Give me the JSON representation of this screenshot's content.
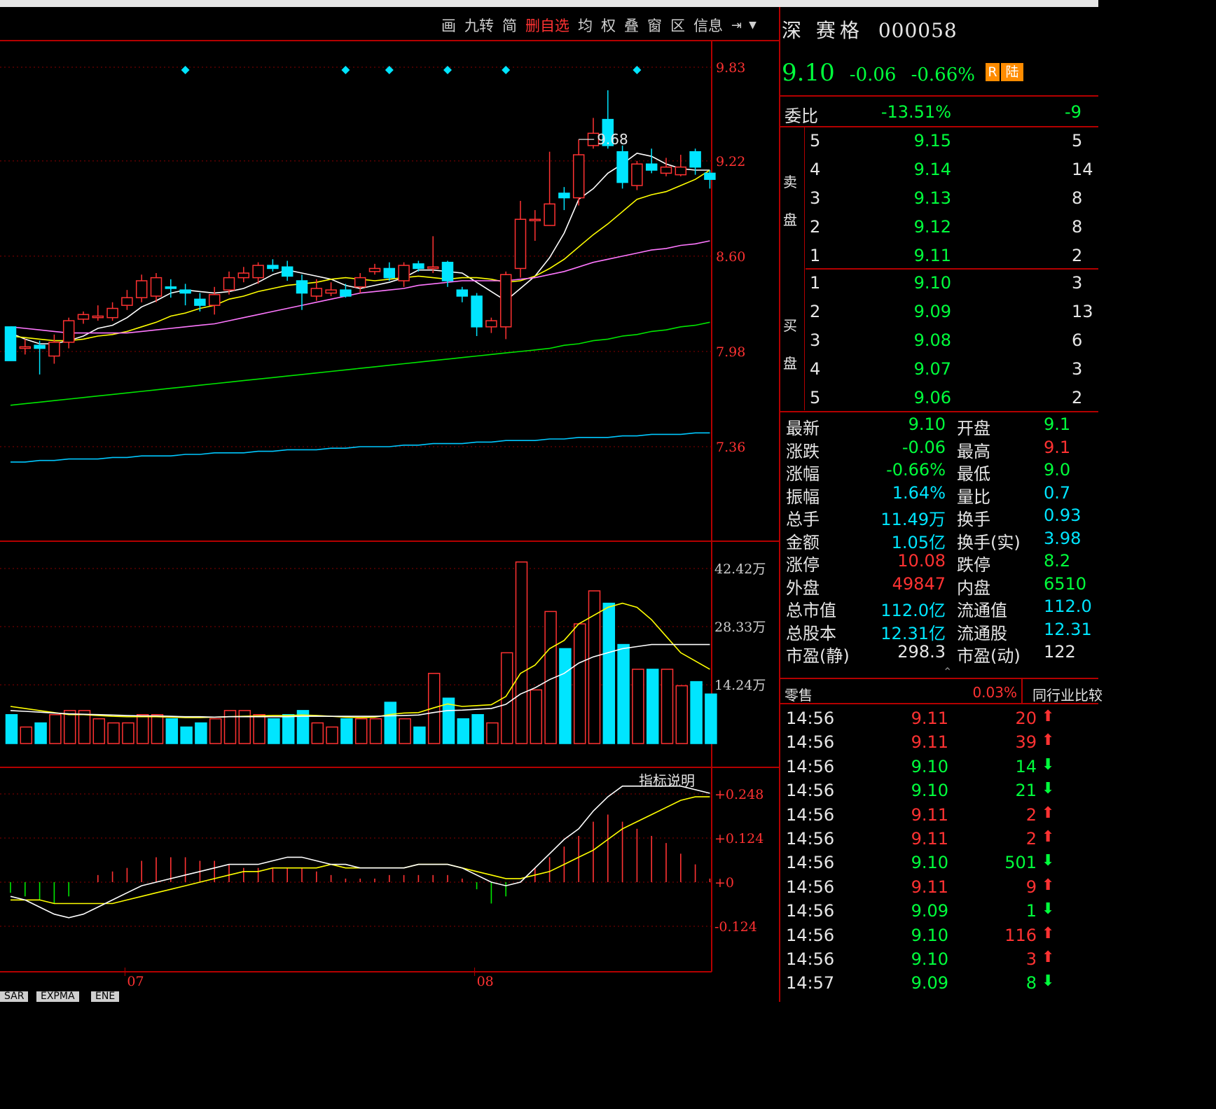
{
  "toolbar": {
    "items": [
      "画",
      "九转",
      "简",
      "删自选",
      "均",
      "权",
      "叠",
      "窗",
      "区",
      "信息"
    ],
    "highlight_index": 3,
    "end_icon": "goto-end-icon",
    "dropdown_icon": "dropdown-icon"
  },
  "stock": {
    "market": "深",
    "name": "赛格",
    "code": "000058",
    "price": "9.10",
    "change": "-0.06",
    "change_pct": "-0.66%",
    "badge_r": "R",
    "badge_lu": "陆"
  },
  "order_book": {
    "weibi_label": "委比",
    "weibi_value": "-13.51%",
    "weicha_partial": "-9",
    "sell_label": [
      "卖",
      "盘"
    ],
    "buy_label": [
      "买",
      "盘"
    ],
    "sell": [
      {
        "level": "5",
        "price": "9.15",
        "vol": "5"
      },
      {
        "level": "4",
        "price": "9.14",
        "vol": "14"
      },
      {
        "level": "3",
        "price": "9.13",
        "vol": "8"
      },
      {
        "level": "2",
        "price": "9.12",
        "vol": "8"
      },
      {
        "level": "1",
        "price": "9.11",
        "vol": "2"
      }
    ],
    "buy": [
      {
        "level": "1",
        "price": "9.10",
        "vol": "3"
      },
      {
        "level": "2",
        "price": "9.09",
        "vol": "13"
      },
      {
        "level": "3",
        "price": "9.08",
        "vol": "6"
      },
      {
        "level": "4",
        "price": "9.07",
        "vol": "3"
      },
      {
        "level": "5",
        "price": "9.06",
        "vol": "2"
      }
    ]
  },
  "stats": [
    {
      "l1": "最新",
      "v1": "9.10",
      "c1": "grn",
      "l2": "开盘",
      "v2": "9.1",
      "c2": "grn"
    },
    {
      "l1": "涨跌",
      "v1": "-0.06",
      "c1": "grn",
      "l2": "最高",
      "v2": "9.1",
      "c2": "red"
    },
    {
      "l1": "涨幅",
      "v1": "-0.66%",
      "c1": "grn",
      "l2": "最低",
      "v2": "9.0",
      "c2": "grn"
    },
    {
      "l1": "振幅",
      "v1": "1.64%",
      "c1": "cyan",
      "l2": "量比",
      "v2": "0.7",
      "c2": "cyan"
    },
    {
      "l1": "总手",
      "v1": "11.49万",
      "c1": "cyan",
      "l2": "换手",
      "v2": "0.93",
      "c2": "cyan"
    },
    {
      "l1": "金额",
      "v1": "1.05亿",
      "c1": "cyan",
      "l2": "换手(实)",
      "v2": "3.98",
      "c2": "cyan"
    },
    {
      "l1": "涨停",
      "v1": "10.08",
      "c1": "red",
      "l2": "跌停",
      "v2": "8.2",
      "c2": "grn"
    },
    {
      "l1": "外盘",
      "v1": "49847",
      "c1": "red",
      "l2": "内盘",
      "v2": "6510",
      "c2": "grn"
    },
    {
      "l1": "总市值",
      "v1": "112.0亿",
      "c1": "cyan",
      "l2": "流通值",
      "v2": "112.0",
      "c2": "cyan"
    },
    {
      "l1": "总股本",
      "v1": "12.31亿",
      "c1": "cyan",
      "l2": "流通股",
      "v2": "12.31",
      "c2": "cyan"
    },
    {
      "l1": "市盈(静)",
      "v1": "298.3",
      "c1": "wht",
      "l2": "市盈(动)",
      "v2": "122",
      "c2": "wht"
    }
  ],
  "sector": {
    "label": "零售",
    "value": "0.03%",
    "compare_label": "同行业比较",
    "collapse_icon": "chevron-up-icon"
  },
  "ticks": [
    {
      "time": "14:56",
      "price": "9.11",
      "vol": "20",
      "dir": "up"
    },
    {
      "time": "14:56",
      "price": "9.11",
      "vol": "39",
      "dir": "up"
    },
    {
      "time": "14:56",
      "price": "9.10",
      "vol": "14",
      "dir": "down"
    },
    {
      "time": "14:56",
      "price": "9.10",
      "vol": "21",
      "dir": "down"
    },
    {
      "time": "14:56",
      "price": "9.11",
      "vol": "2",
      "dir": "up"
    },
    {
      "time": "14:56",
      "price": "9.11",
      "vol": "2",
      "dir": "up"
    },
    {
      "time": "14:56",
      "price": "9.10",
      "vol": "501",
      "dir": "down"
    },
    {
      "time": "14:56",
      "price": "9.11",
      "vol": "9",
      "dir": "up"
    },
    {
      "time": "14:56",
      "price": "9.09",
      "vol": "1",
      "dir": "down"
    },
    {
      "time": "14:56",
      "price": "9.10",
      "vol": "116",
      "dir": "up"
    },
    {
      "time": "14:56",
      "price": "9.10",
      "vol": "3",
      "dir": "up"
    },
    {
      "time": "14:57",
      "price": "9.09",
      "vol": "8",
      "dir": "down"
    }
  ],
  "bottom_tabs": [
    "SAR",
    "EXPMA",
    "ENE"
  ],
  "indicator_help": "指标说明",
  "chart_data": {
    "type": "candlestick",
    "price_axis": {
      "ticks": [
        "9.83",
        "9.22",
        "8.60",
        "7.98",
        "7.36"
      ],
      "range": [
        6.8,
        10.0
      ]
    },
    "volume_axis": {
      "ticks": [
        "42.42万",
        "28.33万",
        "14.24万"
      ],
      "range": [
        0,
        44
      ]
    },
    "macd_axis": {
      "ticks": [
        "+0.248",
        "+0.124",
        "+0",
        "-0.124"
      ],
      "range": [
        -0.22,
        0.32
      ]
    },
    "x_labels": [
      "07",
      "08"
    ],
    "x_label_index": [
      8,
      32
    ],
    "high_annotation": "9.68",
    "high_index": 39,
    "diamond_indices": [
      12,
      23,
      26,
      30,
      34,
      43
    ],
    "candles": [
      [
        8.14,
        7.92,
        8.14,
        7.92
      ],
      [
        8.0,
        8.01,
        8.06,
        7.96
      ],
      [
        8.02,
        8.0,
        8.05,
        7.83
      ],
      [
        7.95,
        8.04,
        8.09,
        7.9
      ],
      [
        8.04,
        8.18,
        8.2,
        8.0
      ],
      [
        8.19,
        8.22,
        8.24,
        8.16
      ],
      [
        8.2,
        8.21,
        8.28,
        8.18
      ],
      [
        8.2,
        8.26,
        8.3,
        8.18
      ],
      [
        8.28,
        8.33,
        8.38,
        8.25
      ],
      [
        8.33,
        8.44,
        8.48,
        8.3
      ],
      [
        8.34,
        8.46,
        8.49,
        8.3
      ],
      [
        8.4,
        8.39,
        8.45,
        8.33
      ],
      [
        8.38,
        8.36,
        8.42,
        8.28
      ],
      [
        8.32,
        8.28,
        8.36,
        8.24
      ],
      [
        8.28,
        8.35,
        8.4,
        8.22
      ],
      [
        8.38,
        8.46,
        8.5,
        8.35
      ],
      [
        8.46,
        8.49,
        8.53,
        8.43
      ],
      [
        8.46,
        8.54,
        8.56,
        8.42
      ],
      [
        8.54,
        8.52,
        8.58,
        8.5
      ],
      [
        8.53,
        8.47,
        8.57,
        8.44
      ],
      [
        8.44,
        8.36,
        8.48,
        8.25
      ],
      [
        8.34,
        8.39,
        8.45,
        8.31
      ],
      [
        8.36,
        8.38,
        8.43,
        8.34
      ],
      [
        8.38,
        8.34,
        8.42,
        8.33
      ],
      [
        8.4,
        8.46,
        8.49,
        8.36
      ],
      [
        8.5,
        8.52,
        8.55,
        8.48
      ],
      [
        8.52,
        8.46,
        8.56,
        8.44
      ],
      [
        8.44,
        8.54,
        8.56,
        8.4
      ],
      [
        8.55,
        8.52,
        8.57,
        8.5
      ],
      [
        8.52,
        8.53,
        8.73,
        8.49
      ],
      [
        8.56,
        8.44,
        8.57,
        8.4
      ],
      [
        8.38,
        8.34,
        8.4,
        8.3
      ],
      [
        8.34,
        8.14,
        8.36,
        8.08
      ],
      [
        8.14,
        8.18,
        8.2,
        8.1
      ],
      [
        8.14,
        8.48,
        8.5,
        8.06
      ],
      [
        8.52,
        8.84,
        8.96,
        8.46
      ],
      [
        8.84,
        8.84,
        8.9,
        8.7
      ],
      [
        8.8,
        8.94,
        9.28,
        8.8
      ],
      [
        9.01,
        8.98,
        9.05,
        8.9
      ],
      [
        8.98,
        9.26,
        9.36,
        8.93
      ],
      [
        9.32,
        9.4,
        9.5,
        9.3
      ],
      [
        9.49,
        9.32,
        9.68,
        9.3
      ],
      [
        9.28,
        9.08,
        9.32,
        9.04
      ],
      [
        9.06,
        9.2,
        9.22,
        9.03
      ],
      [
        9.2,
        9.16,
        9.3,
        9.14
      ],
      [
        9.14,
        9.18,
        9.24,
        9.12
      ],
      [
        9.13,
        9.18,
        9.26,
        9.12
      ],
      [
        9.28,
        9.18,
        9.3,
        9.13
      ],
      [
        9.14,
        9.1,
        9.16,
        9.04
      ]
    ],
    "ma": [
      {
        "name": "MA5",
        "color": "#ffffff",
        "values": [
          8.1,
          8.06,
          8.03,
          8.03,
          8.05,
          8.08,
          8.13,
          8.15,
          8.2,
          8.27,
          8.31,
          8.36,
          8.38,
          8.37,
          8.36,
          8.37,
          8.39,
          8.43,
          8.48,
          8.51,
          8.49,
          8.47,
          8.45,
          8.41,
          8.39,
          8.41,
          8.43,
          8.46,
          8.51,
          8.51,
          8.5,
          8.49,
          8.43,
          8.37,
          8.31,
          8.39,
          8.47,
          8.59,
          8.75,
          8.97,
          9.04,
          9.14,
          9.2,
          9.27,
          9.25,
          9.2,
          9.17,
          9.16,
          9.16
        ]
      },
      {
        "name": "MA10",
        "color": "#ffff00",
        "values": [
          8.08,
          8.07,
          8.06,
          8.05,
          8.05,
          8.06,
          8.08,
          8.09,
          8.11,
          8.14,
          8.17,
          8.21,
          8.23,
          8.26,
          8.28,
          8.32,
          8.34,
          8.37,
          8.39,
          8.41,
          8.42,
          8.43,
          8.45,
          8.46,
          8.45,
          8.44,
          8.45,
          8.46,
          8.47,
          8.46,
          8.45,
          8.46,
          8.46,
          8.45,
          8.43,
          8.44,
          8.47,
          8.52,
          8.58,
          8.66,
          8.74,
          8.81,
          8.89,
          8.97,
          9.0,
          9.02,
          9.06,
          9.1,
          9.16
        ]
      },
      {
        "name": "MA20",
        "color": "#ff77ff",
        "values": [
          8.14,
          8.13,
          8.12,
          8.11,
          8.1,
          8.1,
          8.1,
          8.1,
          8.1,
          8.11,
          8.12,
          8.13,
          8.14,
          8.15,
          8.16,
          8.18,
          8.2,
          8.22,
          8.24,
          8.26,
          8.28,
          8.3,
          8.32,
          8.34,
          8.36,
          8.37,
          8.38,
          8.39,
          8.41,
          8.42,
          8.43,
          8.44,
          8.44,
          8.44,
          8.44,
          8.45,
          8.46,
          8.48,
          8.5,
          8.53,
          8.56,
          8.58,
          8.6,
          8.62,
          8.64,
          8.65,
          8.67,
          8.68,
          8.7
        ]
      },
      {
        "name": "MA60",
        "color": "#00e600",
        "values": [
          7.63,
          7.64,
          7.65,
          7.66,
          7.67,
          7.68,
          7.69,
          7.7,
          7.71,
          7.72,
          7.73,
          7.74,
          7.75,
          7.76,
          7.77,
          7.78,
          7.79,
          7.8,
          7.81,
          7.82,
          7.83,
          7.84,
          7.85,
          7.86,
          7.87,
          7.88,
          7.89,
          7.9,
          7.91,
          7.92,
          7.93,
          7.94,
          7.95,
          7.96,
          7.97,
          7.98,
          7.99,
          8.0,
          8.02,
          8.03,
          8.05,
          8.06,
          8.08,
          8.09,
          8.11,
          8.12,
          8.14,
          8.15,
          8.17
        ]
      },
      {
        "name": "MA250",
        "color": "#00c8ff",
        "values": [
          7.26,
          7.26,
          7.27,
          7.27,
          7.28,
          7.28,
          7.28,
          7.29,
          7.29,
          7.3,
          7.3,
          7.3,
          7.31,
          7.31,
          7.32,
          7.32,
          7.32,
          7.33,
          7.33,
          7.34,
          7.34,
          7.34,
          7.35,
          7.35,
          7.36,
          7.36,
          7.36,
          7.37,
          7.37,
          7.38,
          7.38,
          7.38,
          7.39,
          7.39,
          7.4,
          7.4,
          7.4,
          7.41,
          7.41,
          7.42,
          7.42,
          7.42,
          7.43,
          7.43,
          7.44,
          7.44,
          7.44,
          7.45,
          7.45
        ]
      }
    ],
    "volume": [
      7,
      4,
      5,
      7,
      8,
      8,
      6,
      5,
      5,
      7,
      7,
      6,
      4,
      5,
      6,
      8,
      8,
      7,
      6,
      7,
      8,
      5,
      4,
      6,
      6,
      6,
      10,
      6,
      4,
      17,
      11,
      6,
      7,
      5,
      22,
      44,
      13,
      32,
      23,
      29,
      37,
      34,
      24,
      18,
      18,
      18,
      14,
      15,
      12
    ],
    "vol_ma": [
      {
        "name": "MAVOL5",
        "color": "#ffff00",
        "values": [
          9,
          8.5,
          8,
          7.5,
          7,
          7,
          6.8,
          6.6,
          6.5,
          6.5,
          6.5,
          6.4,
          6.3,
          6.3,
          6.4,
          6.5,
          6.6,
          6.7,
          6.8,
          6.8,
          6.9,
          6.8,
          6.6,
          6.4,
          6.3,
          6.4,
          7,
          7.4,
          7.5,
          8.6,
          9.6,
          9,
          9.2,
          9.4,
          11.4,
          17,
          19,
          23,
          25,
          29,
          31,
          33,
          34,
          33,
          30,
          26,
          22,
          20,
          18
        ]
      },
      {
        "name": "MAVOL10",
        "color": "#ffffff",
        "values": [
          8,
          7.8,
          7.6,
          7.4,
          7.2,
          7.1,
          7,
          6.9,
          6.8,
          6.7,
          6.7,
          6.6,
          6.5,
          6.5,
          6.4,
          6.5,
          6.5,
          6.5,
          6.5,
          6.5,
          6.6,
          6.6,
          6.6,
          6.6,
          6.6,
          6.6,
          6.7,
          6.8,
          6.9,
          7.5,
          8,
          8.1,
          8.3,
          8.5,
          9.5,
          12,
          13.5,
          15.5,
          17,
          19.5,
          21,
          22,
          23,
          23.5,
          24,
          24,
          24,
          24,
          24
        ]
      }
    ],
    "macd": {
      "dif": [
        -0.04,
        -0.05,
        -0.07,
        -0.09,
        -0.1,
        -0.09,
        -0.07,
        -0.05,
        -0.03,
        -0.01,
        0.0,
        0.01,
        0.02,
        0.03,
        0.04,
        0.05,
        0.05,
        0.05,
        0.06,
        0.07,
        0.07,
        0.06,
        0.05,
        0.05,
        0.04,
        0.04,
        0.04,
        0.04,
        0.05,
        0.05,
        0.05,
        0.04,
        0.02,
        0.0,
        -0.01,
        0.0,
        0.04,
        0.08,
        0.12,
        0.15,
        0.2,
        0.24,
        0.27,
        0.27,
        0.27,
        0.27,
        0.27,
        0.26,
        0.25
      ],
      "dea": [
        -0.05,
        -0.05,
        -0.05,
        -0.06,
        -0.06,
        -0.06,
        -0.06,
        -0.06,
        -0.05,
        -0.04,
        -0.03,
        -0.02,
        -0.01,
        0.0,
        0.01,
        0.02,
        0.03,
        0.03,
        0.04,
        0.04,
        0.04,
        0.04,
        0.05,
        0.04,
        0.04,
        0.04,
        0.04,
        0.04,
        0.05,
        0.05,
        0.05,
        0.04,
        0.03,
        0.02,
        0.01,
        0.01,
        0.02,
        0.03,
        0.05,
        0.07,
        0.09,
        0.12,
        0.15,
        0.17,
        0.19,
        0.21,
        0.23,
        0.24,
        0.24
      ],
      "hist": [
        -0.03,
        -0.04,
        -0.05,
        -0.06,
        -0.04,
        0.0,
        0.02,
        0.03,
        0.04,
        0.06,
        0.07,
        0.07,
        0.07,
        0.06,
        0.06,
        0.05,
        0.04,
        0.04,
        0.04,
        0.04,
        0.04,
        0.03,
        0.02,
        0.01,
        0.01,
        0.01,
        0.02,
        0.02,
        0.02,
        0.02,
        0.02,
        0.01,
        -0.02,
        -0.06,
        -0.04,
        0.0,
        0.04,
        0.07,
        0.1,
        0.13,
        0.17,
        0.19,
        0.17,
        0.15,
        0.13,
        0.11,
        0.08,
        0.05,
        0.01
      ]
    }
  }
}
